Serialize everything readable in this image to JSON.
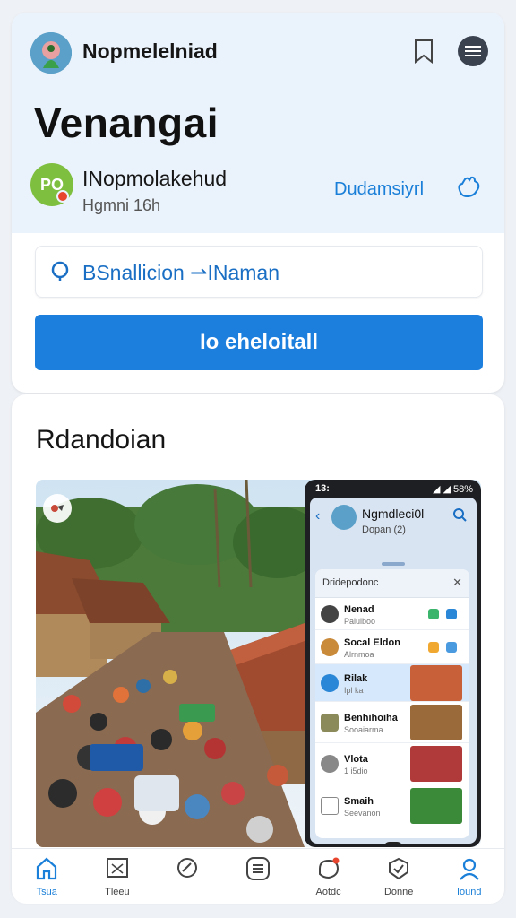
{
  "header": {
    "app_name": "Nopmelelniad",
    "title": "Venangai"
  },
  "user": {
    "name": "INopmolakehud",
    "subtitle": "Hgmni 16h",
    "avatar_initials": "PO",
    "follow_label": "Dudamsiyrl"
  },
  "search": {
    "text": "BSnallicion ⇀INaman"
  },
  "primary_button": {
    "label": "Io eheloitall"
  },
  "section": {
    "title": "Rdandoian"
  },
  "phone": {
    "time": "13:",
    "status_right": "◢ ◢ 58%",
    "title": "Ngmdleci0l",
    "subtitle": "Dopan (2)",
    "panel_title": "Dridepodonc",
    "close": "✕",
    "rows": [
      {
        "name": "Nenad",
        "sub": "Paluiboo"
      },
      {
        "name": "Socal Eldon",
        "sub": "Alrnmoa"
      },
      {
        "name": "Rilak",
        "sub": "Ipl ka"
      },
      {
        "name": "Benhihoiha",
        "sub": "Sooaiarma"
      },
      {
        "name": "Vlota",
        "sub": "1 i5dio"
      },
      {
        "name": "Smaih",
        "sub": "Seevanon"
      }
    ]
  },
  "nav": [
    {
      "label": "Tsua",
      "icon": "home-icon"
    },
    {
      "label": "Tleeu",
      "icon": "image-icon"
    },
    {
      "label": "",
      "icon": "tag-icon"
    },
    {
      "label": "",
      "icon": "list-icon"
    },
    {
      "label": "Aotdc",
      "icon": "notification-icon"
    },
    {
      "label": "Donne",
      "icon": "badge-icon"
    },
    {
      "label": "Iound",
      "icon": "profile-icon"
    }
  ],
  "colors": {
    "accent": "#1c7fde",
    "header_band": "#eaf2fb",
    "notification_dot": "#e8452f"
  }
}
